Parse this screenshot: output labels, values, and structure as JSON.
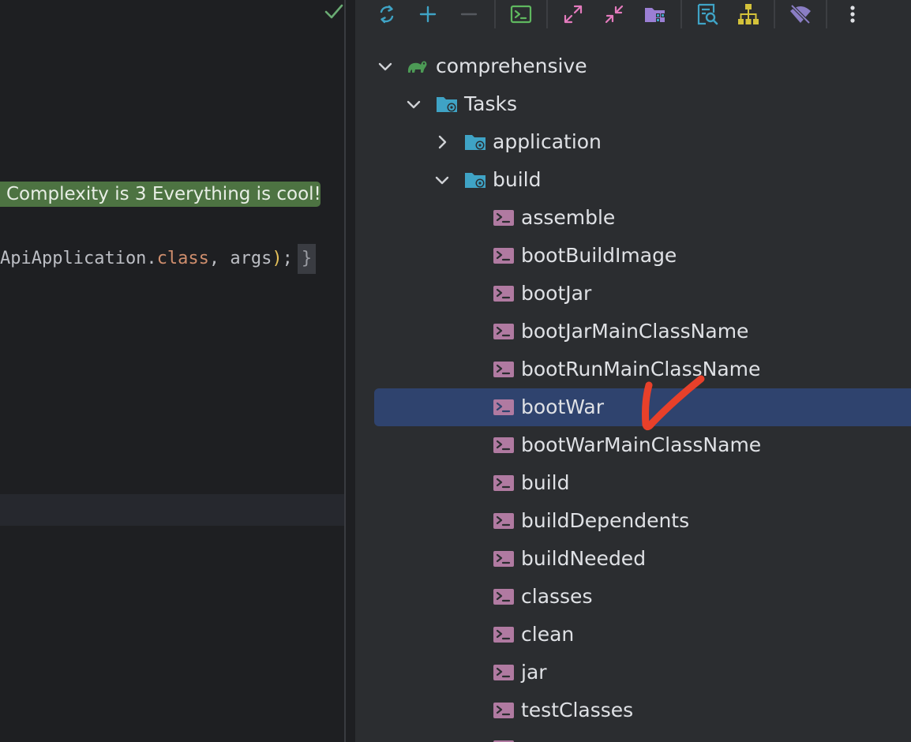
{
  "editor": {
    "inspection_status_icon": "check-icon",
    "hint_text": "Complexity is 3 Everything is cool!",
    "code": {
      "prefix": "ApiApplication.",
      "keyword": "class",
      "mid": ", args",
      "paren": ")",
      "suffix": ";",
      "fold": "}"
    }
  },
  "gradle_toolbar": {
    "buttons": [
      {
        "name": "reload-all-icon"
      },
      {
        "name": "add-icon"
      },
      {
        "name": "remove-icon"
      },
      {
        "name": "execute-task-icon"
      },
      {
        "name": "expand-all-icon"
      },
      {
        "name": "collapse-all-icon"
      },
      {
        "name": "source-sets-icon"
      },
      {
        "name": "analyze-dependencies-icon"
      },
      {
        "name": "show-dependencies-icon"
      },
      {
        "name": "offline-mode-icon"
      },
      {
        "name": "more-options-icon"
      }
    ]
  },
  "tree": {
    "project": "comprehensive",
    "tasks_folder": "Tasks",
    "groups": [
      "application",
      "build"
    ],
    "build_tasks": [
      "assemble",
      "bootBuildImage",
      "bootJar",
      "bootJarMainClassName",
      "bootRunMainClassName",
      "bootWar",
      "bootWarMainClassName",
      "build",
      "buildDependents",
      "buildNeeded",
      "classes",
      "clean",
      "jar",
      "testClasses"
    ],
    "selected_task": "bootWar"
  },
  "colors": {
    "selection": "#2f436e",
    "hint_background": "#4d7342",
    "annotation_mark": "#e8402a",
    "task_icon": "#b07aa1",
    "folder_icon": "#3fa3c5"
  }
}
